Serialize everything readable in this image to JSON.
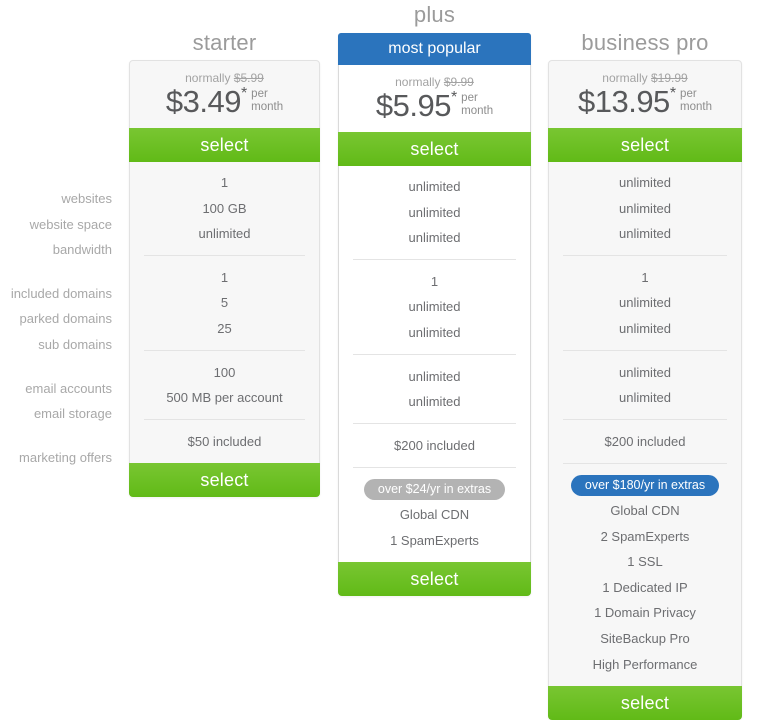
{
  "feature_labels": [
    [
      "websites",
      "website space",
      "bandwidth"
    ],
    [
      "included domains",
      "parked domains",
      "sub domains"
    ],
    [
      "email accounts",
      "email storage"
    ],
    [
      "marketing offers"
    ]
  ],
  "colors": {
    "green": "#6cbe2a",
    "blue": "#2b74bd",
    "gray_pill": "#b3b3b3",
    "card_bg": "#f7f7f7",
    "featured_card_bg": "#ffffff",
    "label_text": "#a8a8a8",
    "value_text": "#6d6e71",
    "title_text": "#9b9b9b"
  },
  "select_label": "select",
  "plans": [
    {
      "id": "starter",
      "title": "starter",
      "badge": null,
      "normally_prefix": "normally",
      "old_price": "$5.99",
      "price": "$3.49",
      "star": "*",
      "per": "per",
      "month": "month",
      "groups": [
        [
          "1",
          "100 GB",
          "unlimited"
        ],
        [
          "1",
          "5",
          "25"
        ],
        [
          "100",
          "500 MB per account"
        ],
        [
          "$50 included"
        ]
      ],
      "extras_pill": null,
      "extras": []
    },
    {
      "id": "plus",
      "title": "plus",
      "badge": "most popular",
      "normally_prefix": "normally",
      "old_price": "$9.99",
      "price": "$5.95",
      "star": "*",
      "per": "per",
      "month": "month",
      "groups": [
        [
          "unlimited",
          "unlimited",
          "unlimited"
        ],
        [
          "1",
          "unlimited",
          "unlimited"
        ],
        [
          "unlimited",
          "unlimited"
        ],
        [
          "$200 included"
        ]
      ],
      "extras_pill": "over $24/yr in extras",
      "extras": [
        "Global CDN",
        "1 SpamExperts"
      ]
    },
    {
      "id": "business-pro",
      "title": "business pro",
      "badge": null,
      "normally_prefix": "normally",
      "old_price": "$19.99",
      "price": "$13.95",
      "star": "*",
      "per": "per",
      "month": "month",
      "groups": [
        [
          "unlimited",
          "unlimited",
          "unlimited"
        ],
        [
          "1",
          "unlimited",
          "unlimited"
        ],
        [
          "unlimited",
          "unlimited"
        ],
        [
          "$200 included"
        ]
      ],
      "extras_pill": "over $180/yr in extras",
      "extras": [
        "Global CDN",
        "2 SpamExperts",
        "1 SSL",
        "1 Dedicated IP",
        "1 Domain Privacy",
        "SiteBackup Pro",
        "High Performance"
      ]
    }
  ]
}
